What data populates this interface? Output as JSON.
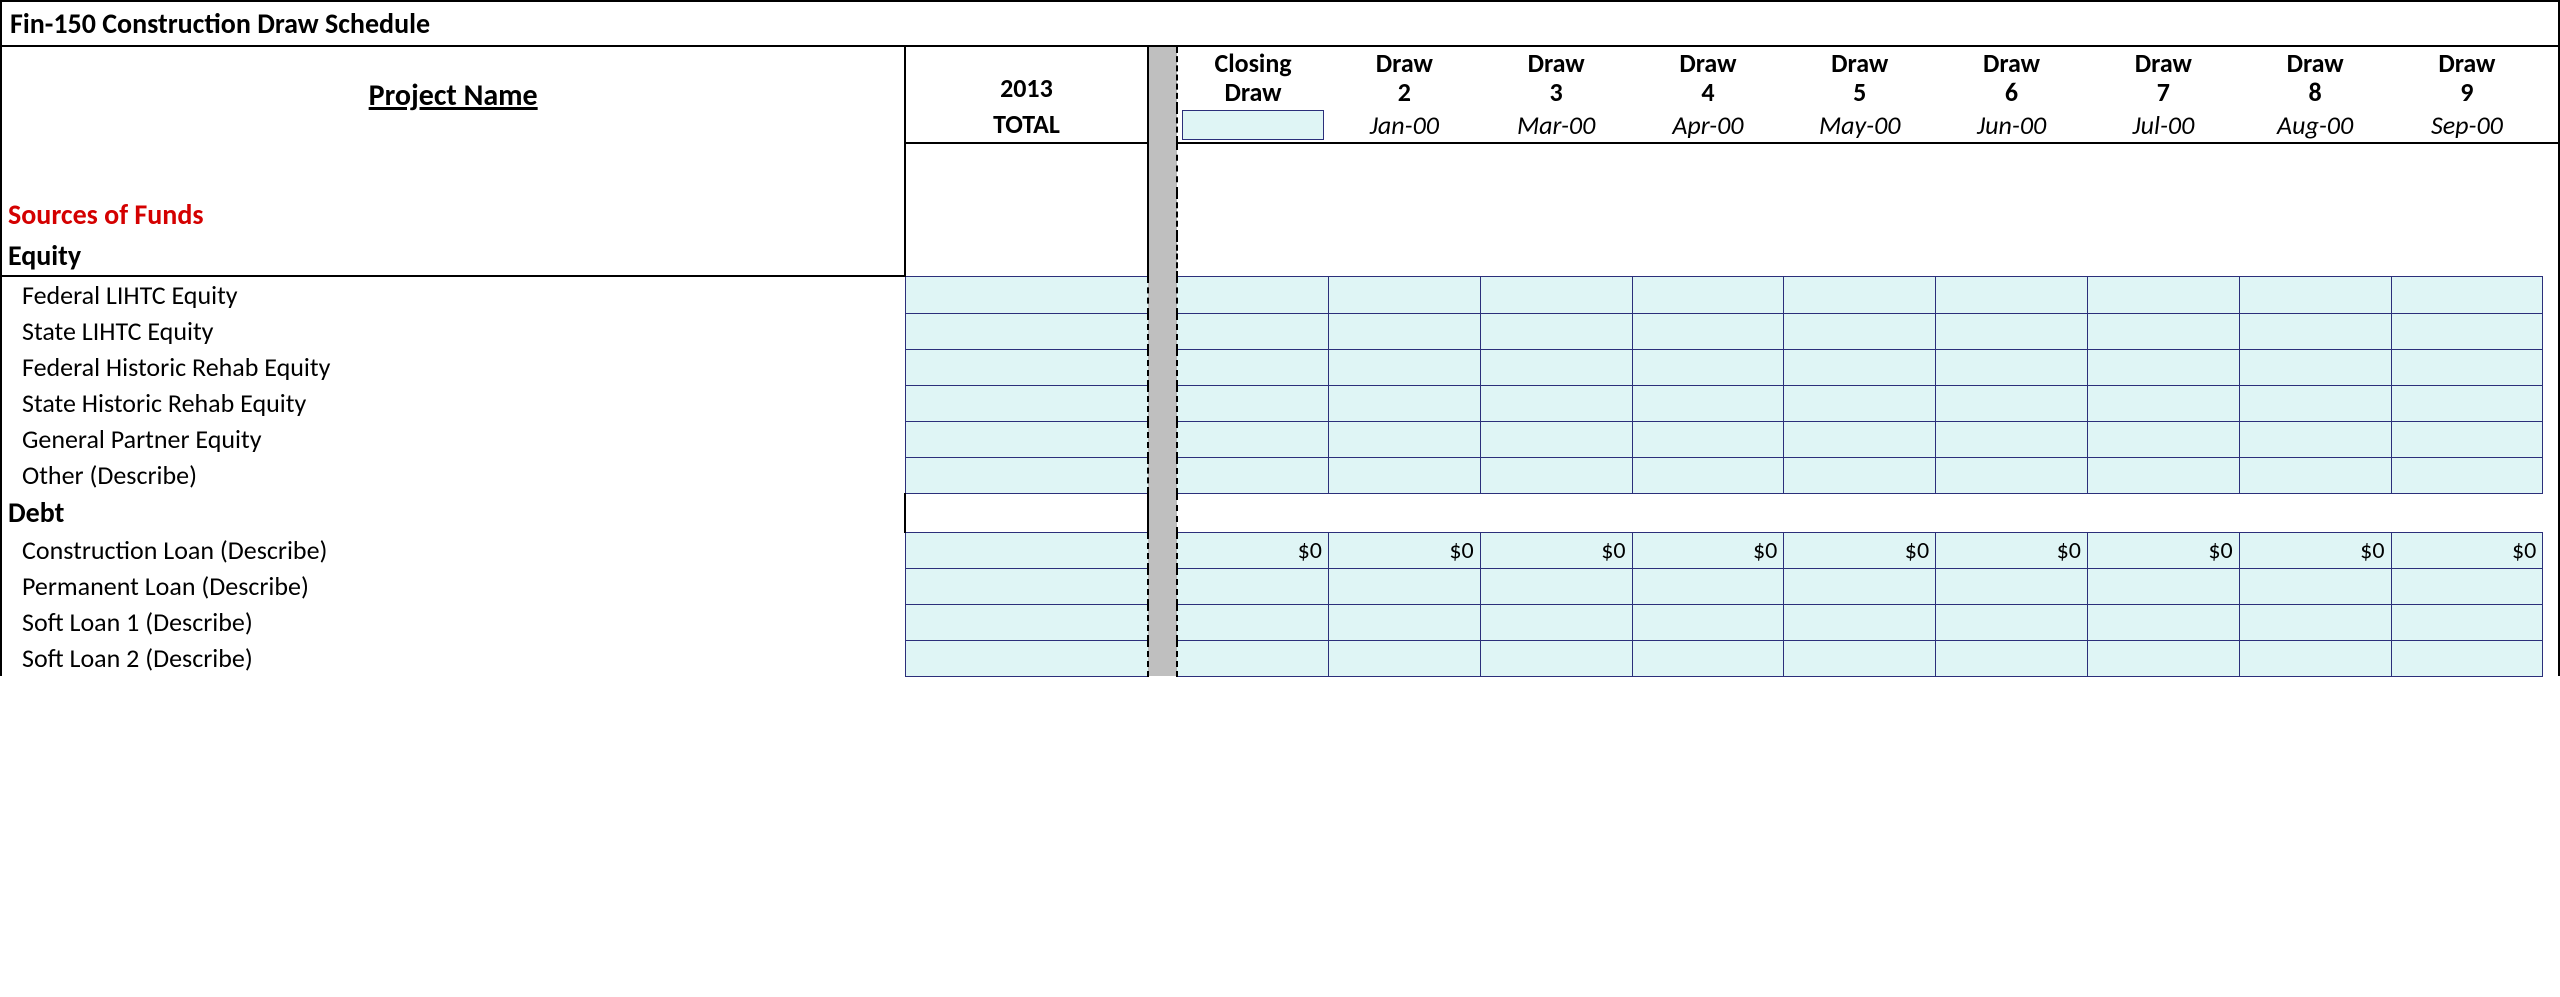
{
  "title": "Fin-150 Construction Draw Schedule",
  "projectNameLabel": "Project Name ",
  "totalHeader": {
    "year": "2013",
    "word": "TOTAL"
  },
  "draws": [
    {
      "top": "Closing",
      "bot": "Draw",
      "month": ""
    },
    {
      "top": "Draw",
      "bot": "2",
      "month": "Jan-00"
    },
    {
      "top": "Draw",
      "bot": "3",
      "month": "Mar-00"
    },
    {
      "top": "Draw",
      "bot": "4",
      "month": "Apr-00"
    },
    {
      "top": "Draw",
      "bot": "5",
      "month": "May-00"
    },
    {
      "top": "Draw",
      "bot": "6",
      "month": "Jun-00"
    },
    {
      "top": "Draw",
      "bot": "7",
      "month": "Jul-00"
    },
    {
      "top": "Draw",
      "bot": "8",
      "month": "Aug-00"
    },
    {
      "top": "Draw",
      "bot": "9",
      "month": "Sep-00"
    }
  ],
  "sections": {
    "sourcesTitle": "Sources of Funds",
    "equityTitle": "Equity",
    "equityRows": [
      "Federal LIHTC Equity",
      "State LIHTC Equity",
      "Federal Historic Rehab Equity",
      "State Historic Rehab Equity",
      "General Partner Equity",
      "Other (Describe)"
    ],
    "debtTitle": "Debt",
    "debtRows": [
      {
        "label": "Construction Loan (Describe)",
        "values": [
          "$0",
          "$0",
          "$0",
          "$0",
          "$0",
          "$0",
          "$0",
          "$0",
          "$0"
        ]
      },
      {
        "label": "Permanent Loan (Describe)",
        "values": [
          "",
          "",
          "",
          "",
          "",
          "",
          "",
          "",
          ""
        ]
      },
      {
        "label": "Soft Loan 1 (Describe)",
        "values": [
          "",
          "",
          "",
          "",
          "",
          "",
          "",
          "",
          ""
        ]
      },
      {
        "label": "Soft Loan 2 (Describe)",
        "values": [
          "",
          "",
          "",
          "",
          "",
          "",
          "",
          "",
          ""
        ]
      }
    ]
  }
}
